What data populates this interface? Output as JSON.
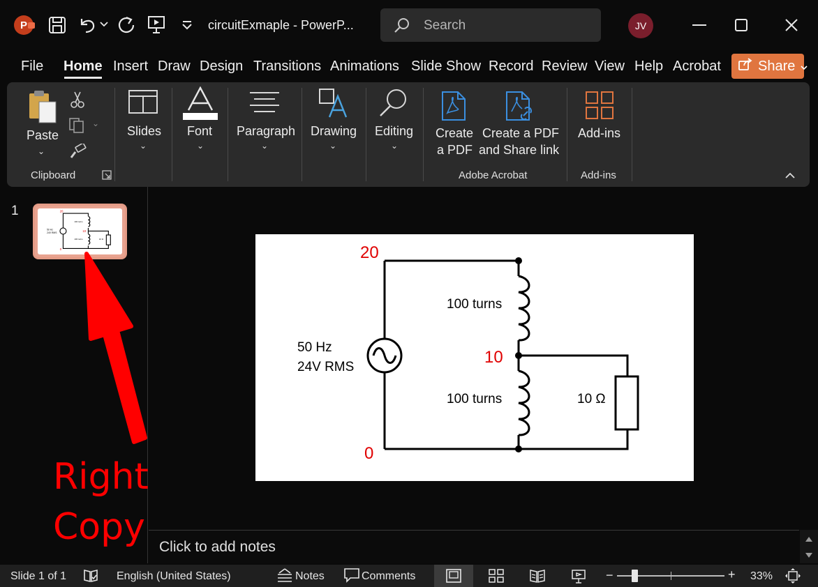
{
  "titlebar": {
    "doc_title": "circuitExmaple  -  PowerP...",
    "search_placeholder": "Search",
    "user_initials": "JV"
  },
  "tabs": [
    "File",
    "Home",
    "Insert",
    "Draw",
    "Design",
    "Transitions",
    "Animations",
    "Slide Show",
    "Record",
    "Review",
    "View",
    "Help",
    "Acrobat"
  ],
  "share_label": "Share",
  "ribbon": {
    "paste": "Paste",
    "clipboard_group": "Clipboard",
    "slides": "Slides",
    "font": "Font",
    "paragraph": "Paragraph",
    "drawing": "Drawing",
    "editing": "Editing",
    "create_pdf_1": "Create",
    "create_pdf_2": "a PDF",
    "create_share_1": "Create a PDF",
    "create_share_2": "and Share link",
    "acrobat_group": "Adobe Acrobat",
    "addins": "Add-ins",
    "addins_group": "Add-ins"
  },
  "thumbnail": {
    "slide_number": "1"
  },
  "annotation": {
    "line1": "Right-click",
    "line2": "Copy"
  },
  "slide": {
    "node_top": "20",
    "node_mid": "10",
    "node_bottom": "0",
    "source_line1": "50 Hz",
    "source_line2": "24V RMS",
    "coil_top": "100 turns",
    "coil_bottom": "100 turns",
    "resistor": "10 Ω"
  },
  "notes_placeholder": "Click to add notes",
  "statusbar": {
    "slide_info": "Slide 1 of 1",
    "language": "English (United States)",
    "notes": "Notes",
    "comments": "Comments",
    "zoom": "33%"
  },
  "colors": {
    "accent": "#e0753f",
    "annotation_red": "#ff0000",
    "node_label_red": "#e00000"
  }
}
